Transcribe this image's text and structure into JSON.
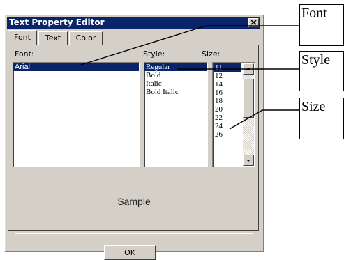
{
  "window": {
    "title": "Text Property Editor"
  },
  "tabs": [
    {
      "label": "Font"
    },
    {
      "label": "Text"
    },
    {
      "label": "Color"
    }
  ],
  "font_section": {
    "font_label": "Font:",
    "style_label": "Style:",
    "size_label": "Size:",
    "fonts": [
      "Arial"
    ],
    "selected_font": "Arial",
    "styles": [
      "Regular",
      "Bold",
      "Italic",
      "Bold Italic"
    ],
    "selected_style": "Regular",
    "sizes": [
      "11",
      "12",
      "14",
      "16",
      "18",
      "20",
      "22",
      "24",
      "26"
    ],
    "selected_size": "11"
  },
  "sample": {
    "text": "Sample"
  },
  "buttons": {
    "ok": "OK"
  },
  "callouts": {
    "font": "Font",
    "style": "Style",
    "size": "Size"
  },
  "colors": {
    "title_bar": "#0a246a",
    "dialog_face": "#d4d0c8",
    "selection": "#0a246a"
  }
}
